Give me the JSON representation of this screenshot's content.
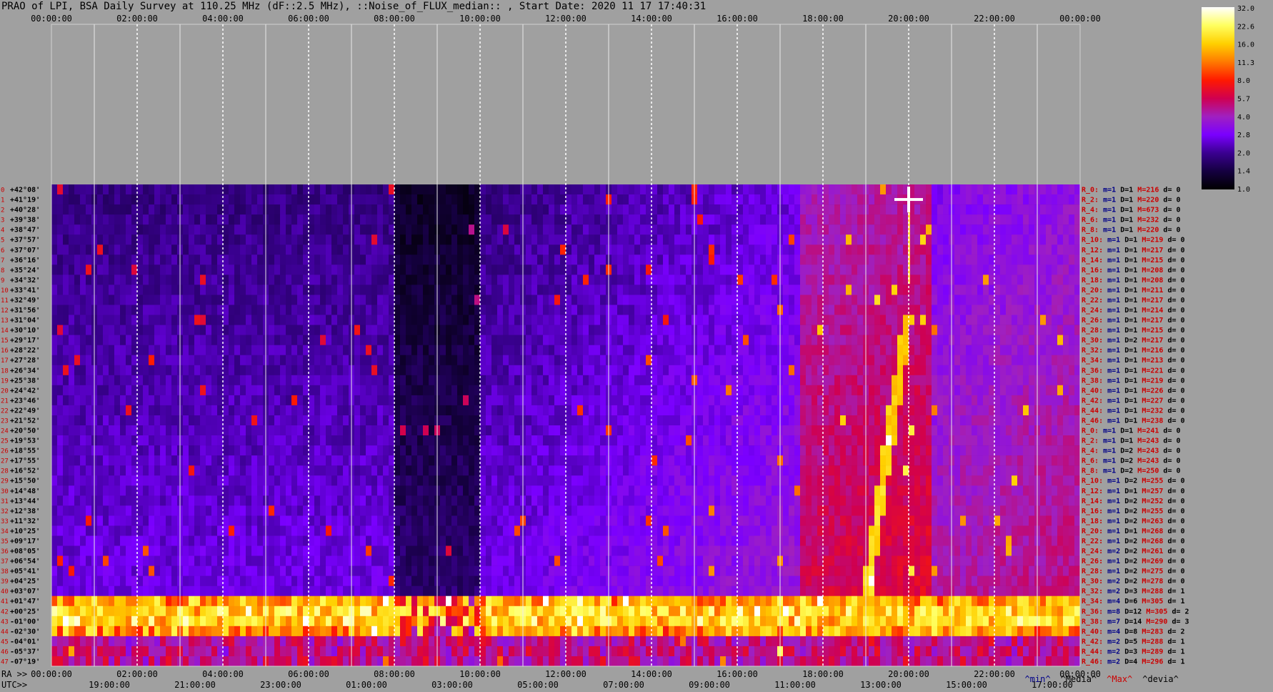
{
  "title": "PRAO of LPI, BSA Daily Survey at 110.25 MHz (dF::2.5 MHz), ::Noise_of_FLUX_median:: , Start Date: 2020 11 17 17:40:31",
  "colors": {
    "background": "#a0a0a0",
    "ra_labels": "#000000",
    "utc_labels": "#000000",
    "row_index": "#cc0000",
    "stat_red": "#cc0000",
    "stat_blue": "#000088"
  },
  "chart_data": {
    "type": "heatmap",
    "ra_ticks": [
      "00:00:00",
      "02:00:00",
      "04:00:00",
      "06:00:00",
      "08:00:00",
      "10:00:00",
      "12:00:00",
      "14:00:00",
      "16:00:00",
      "18:00:00",
      "20:00:00",
      "22:00:00",
      "00:00:00"
    ],
    "bottom_ra_prefix": "RA >>",
    "bottom_ra_ticks": [
      "00:00:00",
      "02:00:00",
      "04:00:00",
      "06:00:00",
      "08:00:00",
      "10:00:00",
      "12:00:00",
      "14:00:00",
      "16:00:00",
      "18:00:00",
      "20:00:00",
      "22:00:00",
      "00:00:00"
    ],
    "utc_prefix": "UTC>>",
    "utc_ticks": [
      "19:00:00",
      "21:00:00",
      "23:00:00",
      "01:00:00",
      "03:00:00",
      "05:00:00",
      "07:00:00",
      "09:00:00",
      "11:00:00",
      "13:00:00",
      "15:00:00",
      "17:00:00"
    ],
    "declinations": [
      "+42°08'",
      "+41°19'",
      "+40°28'",
      "+39°38'",
      "+38°47'",
      "+37°57'",
      "+37°07'",
      "+36°16'",
      "+35°24'",
      "+34°32'",
      "+33°41'",
      "+32°49'",
      "+31°56'",
      "+31°04'",
      "+30°10'",
      "+29°17'",
      "+28°22'",
      "+27°28'",
      "+26°34'",
      "+25°38'",
      "+24°42'",
      "+23°46'",
      "+22°49'",
      "+21°52'",
      "+20°50'",
      "+19°53'",
      "+18°55'",
      "+17°55'",
      "+16°52'",
      "+15°50'",
      "+14°48'",
      "+13°44'",
      "+12°38'",
      "+11°32'",
      "+10°25'",
      "+09°17'",
      "+08°05'",
      "+06°54'",
      "+05°41'",
      "+04°25'",
      "+03°07'",
      "+01°47'",
      "+00°25'",
      "-01°00'",
      "-02°30'",
      "-04°01'",
      "-05°37'",
      "-07°19'"
    ],
    "row_stats": [
      {
        "r": "R_0:",
        "m": "m=1",
        "D": "D=1",
        "M": "M=216",
        "d": "d= 0"
      },
      {
        "r": "R_2:",
        "m": "m=1",
        "D": "D=1",
        "M": "M=220",
        "d": "d= 0"
      },
      {
        "r": "R_4:",
        "m": "m=1",
        "D": "D=1",
        "M": "M=673",
        "d": "d= 0"
      },
      {
        "r": "R_6:",
        "m": "m=1",
        "D": "D=1",
        "M": "M=232",
        "d": "d= 0"
      },
      {
        "r": "R_8:",
        "m": "m=1",
        "D": "D=1",
        "M": "M=220",
        "d": "d= 0"
      },
      {
        "r": "R_10:",
        "m": "m=1",
        "D": "D=1",
        "M": "M=219",
        "d": "d= 0"
      },
      {
        "r": "R_12:",
        "m": "m=1",
        "D": "D=1",
        "M": "M=217",
        "d": "d= 0"
      },
      {
        "r": "R_14:",
        "m": "m=1",
        "D": "D=1",
        "M": "M=215",
        "d": "d= 0"
      },
      {
        "r": "R_16:",
        "m": "m=1",
        "D": "D=1",
        "M": "M=208",
        "d": "d= 0"
      },
      {
        "r": "R_18:",
        "m": "m=1",
        "D": "D=1",
        "M": "M=208",
        "d": "d= 0"
      },
      {
        "r": "R_20:",
        "m": "m=1",
        "D": "D=1",
        "M": "M=211",
        "d": "d= 0"
      },
      {
        "r": "R_22:",
        "m": "m=1",
        "D": "D=1",
        "M": "M=217",
        "d": "d= 0"
      },
      {
        "r": "R_24:",
        "m": "m=1",
        "D": "D=1",
        "M": "M=214",
        "d": "d= 0"
      },
      {
        "r": "R_26:",
        "m": "m=1",
        "D": "D=1",
        "M": "M=217",
        "d": "d= 0"
      },
      {
        "r": "R_28:",
        "m": "m=1",
        "D": "D=1",
        "M": "M=215",
        "d": "d= 0"
      },
      {
        "r": "R_30:",
        "m": "m=1",
        "D": "D=2",
        "M": "M=217",
        "d": "d= 0"
      },
      {
        "r": "R_32:",
        "m": "m=1",
        "D": "D=1",
        "M": "M=216",
        "d": "d= 0"
      },
      {
        "r": "R_34:",
        "m": "m=1",
        "D": "D=1",
        "M": "M=213",
        "d": "d= 0"
      },
      {
        "r": "R_36:",
        "m": "m=1",
        "D": "D=1",
        "M": "M=221",
        "d": "d= 0"
      },
      {
        "r": "R_38:",
        "m": "m=1",
        "D": "D=1",
        "M": "M=219",
        "d": "d= 0"
      },
      {
        "r": "R_40:",
        "m": "m=1",
        "D": "D=1",
        "M": "M=226",
        "d": "d= 0"
      },
      {
        "r": "R_42:",
        "m": "m=1",
        "D": "D=1",
        "M": "M=227",
        "d": "d= 0"
      },
      {
        "r": "R_44:",
        "m": "m=1",
        "D": "D=1",
        "M": "M=232",
        "d": "d= 0"
      },
      {
        "r": "R_46:",
        "m": "m=1",
        "D": "D=1",
        "M": "M=238",
        "d": "d= 0"
      },
      {
        "r": "R_0:",
        "m": "m=1",
        "D": "D=1",
        "M": "M=241",
        "d": "d= 0"
      },
      {
        "r": "R_2:",
        "m": "m=1",
        "D": "D=1",
        "M": "M=243",
        "d": "d= 0"
      },
      {
        "r": "R_4:",
        "m": "m=1",
        "D": "D=2",
        "M": "M=243",
        "d": "d= 0"
      },
      {
        "r": "R_6:",
        "m": "m=1",
        "D": "D=2",
        "M": "M=243",
        "d": "d= 0"
      },
      {
        "r": "R_8:",
        "m": "m=1",
        "D": "D=2",
        "M": "M=250",
        "d": "d= 0"
      },
      {
        "r": "R_10:",
        "m": "m=1",
        "D": "D=2",
        "M": "M=255",
        "d": "d= 0"
      },
      {
        "r": "R_12:",
        "m": "m=1",
        "D": "D=1",
        "M": "M=257",
        "d": "d= 0"
      },
      {
        "r": "R_14:",
        "m": "m=1",
        "D": "D=2",
        "M": "M=252",
        "d": "d= 0"
      },
      {
        "r": "R_16:",
        "m": "m=1",
        "D": "D=2",
        "M": "M=255",
        "d": "d= 0"
      },
      {
        "r": "R_18:",
        "m": "m=1",
        "D": "D=2",
        "M": "M=263",
        "d": "d= 0"
      },
      {
        "r": "R_20:",
        "m": "m=1",
        "D": "D=1",
        "M": "M=268",
        "d": "d= 0"
      },
      {
        "r": "R_22:",
        "m": "m=1",
        "D": "D=2",
        "M": "M=268",
        "d": "d= 0"
      },
      {
        "r": "R_24:",
        "m": "m=2",
        "D": "D=2",
        "M": "M=261",
        "d": "d= 0"
      },
      {
        "r": "R_26:",
        "m": "m=1",
        "D": "D=2",
        "M": "M=269",
        "d": "d= 0"
      },
      {
        "r": "R_28:",
        "m": "m=1",
        "D": "D=2",
        "M": "M=275",
        "d": "d= 0"
      },
      {
        "r": "R_30:",
        "m": "m=2",
        "D": "D=2",
        "M": "M=278",
        "d": "d= 0"
      },
      {
        "r": "R_32:",
        "m": "m=2",
        "D": "D=3",
        "M": "M=288",
        "d": "d= 1"
      },
      {
        "r": "R_34:",
        "m": "m=4",
        "D": "D=6",
        "M": "M=305",
        "d": "d= 1"
      },
      {
        "r": "R_36:",
        "m": "m=8",
        "D": "D=12",
        "M": "M=305",
        "d": "d= 2"
      },
      {
        "r": "R_38:",
        "m": "m=7",
        "D": "D=14",
        "M": "M=290",
        "d": "d= 3"
      },
      {
        "r": "R_40:",
        "m": "m=4",
        "D": "D=8",
        "M": "M=283",
        "d": "d= 2"
      },
      {
        "r": "R_42:",
        "m": "m=2",
        "D": "D=5",
        "M": "M=288",
        "d": "d= 1"
      },
      {
        "r": "R_44:",
        "m": "m=2",
        "D": "D=3",
        "M": "M=289",
        "d": "d= 1"
      },
      {
        "r": "R_46:",
        "m": "m=2",
        "D": "D=4",
        "M": "M=296",
        "d": "d= 1"
      }
    ],
    "colorbar": {
      "ticks": [
        "32.0",
        "22.6",
        "16.0",
        "11.3",
        "8.0",
        "5.7",
        "4.0",
        "2.8",
        "2.0",
        "1.4",
        "1.0"
      ],
      "stops": [
        "#ffffff",
        "#ffff60",
        "#ffd000",
        "#ff7a00",
        "#ff1a00",
        "#d00050",
        "#a020c0",
        "#7a00ff",
        "#3a0090",
        "#150040",
        "#000000"
      ]
    },
    "legend_labels": [
      "^min^",
      "^Media^",
      "^Max^",
      "^devia^"
    ],
    "legend_colors": [
      "#000088",
      "#000000",
      "#cc0000",
      "#000000"
    ],
    "features": {
      "bright_band_decs": [
        "+01°47'",
        "+00°25'",
        "-01°00'",
        "-02°30'"
      ],
      "dark_region_ra": [
        "08:00:00",
        "10:00:00"
      ],
      "streak_ra": [
        "18:45:00",
        "20:00:00"
      ],
      "source_ra": "20:00:00",
      "source_dec": "+41°19'"
    }
  }
}
